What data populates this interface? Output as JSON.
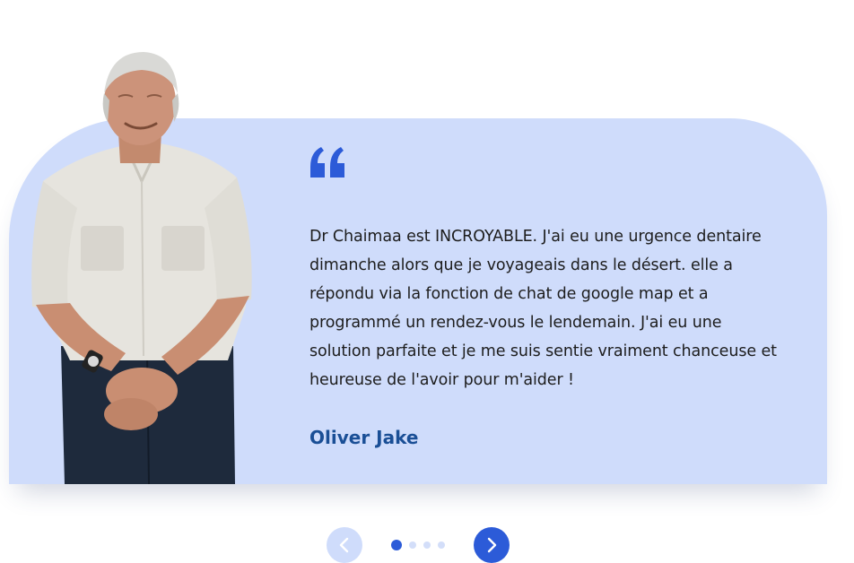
{
  "testimonial": {
    "quote_icon": "quote-open-icon",
    "text": "Dr Chaimaa est INCROYABLE. J'ai eu une urgence dentaire dimanche alors que je voyageais dans le désert. elle a répondu via la fonction de chat de google map et a programmé un rendez-vous le lendemain. J'ai eu une solution parfaite et je me suis sentie vraiment chanceuse et heureuse de l'avoir pour m'aider !",
    "author": "Oliver Jake"
  },
  "carousel": {
    "prev_icon": "chevron-left-icon",
    "next_icon": "chevron-right-icon",
    "dot_count": 4,
    "active_index": 0
  },
  "colors": {
    "card_background": "#cfdcfb",
    "accent": "#2c5bd8",
    "author_text": "#1a4f96",
    "body_text": "#1d1d1d"
  }
}
